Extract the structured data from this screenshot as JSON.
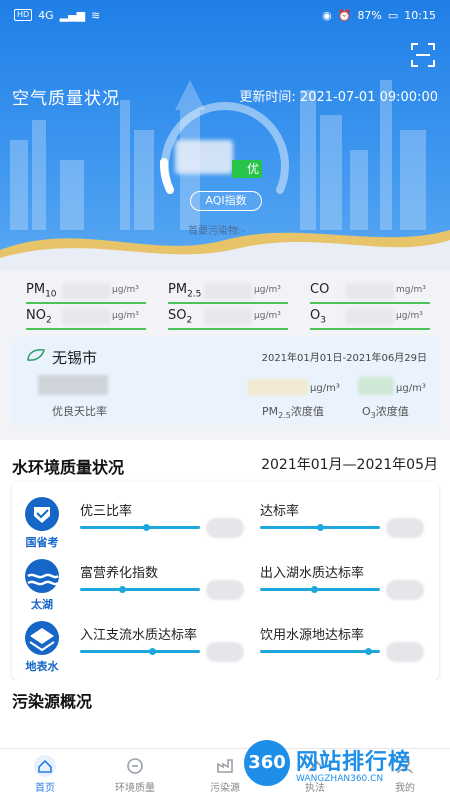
{
  "status_bar": {
    "sim": "HD",
    "net": "4G",
    "battery": "87%",
    "time": "10:15"
  },
  "air": {
    "title": "空气质量状况",
    "update_time": "更新时间: 2021-07-01 09:00:00",
    "aqi_level": "优",
    "aqi_button": "AQI指数",
    "primary_pollutant": "首要污染物:-"
  },
  "pollutants": [
    {
      "name": "PM",
      "sub": "10",
      "unit": "μg/m³"
    },
    {
      "name": "PM",
      "sub": "2.5",
      "unit": "μg/m³"
    },
    {
      "name": "CO",
      "sub": "",
      "unit": "mg/m³"
    },
    {
      "name": "NO",
      "sub": "2",
      "unit": "μg/m³"
    },
    {
      "name": "SO",
      "sub": "2",
      "unit": "μg/m³"
    },
    {
      "name": "O",
      "sub": "3",
      "unit": "μg/m³"
    }
  ],
  "city": {
    "name": "无锡市",
    "date_range": "2021年01月01日-2021年06月29日",
    "unit_pm25": "μg/m³",
    "unit_o3": "μg/m³",
    "label_good_rate": "优良天比率",
    "label_pm25": "PM",
    "label_pm25_sub": "2.5",
    "label_pm25_suffix": "浓度值",
    "label_o3": "O",
    "label_o3_sub": "3",
    "label_o3_suffix": "浓度值"
  },
  "water": {
    "title": "水环境质量状况",
    "date_range": "2021年01月—2021年05月",
    "categories": [
      {
        "label": "国省考",
        "metrics": [
          {
            "name": "优三比率",
            "level": 0.55
          },
          {
            "name": "达标率",
            "level": 0.5
          }
        ]
      },
      {
        "label": "太湖",
        "metrics": [
          {
            "name": "富营养化指数",
            "level": 0.35
          },
          {
            "name": "出入湖水质达标率",
            "level": 0.45
          }
        ]
      },
      {
        "label": "地表水",
        "metrics": [
          {
            "name": "入江支流水质达标率",
            "level": 0.6
          },
          {
            "name": "饮用水源地达标率",
            "level": 0.9
          }
        ]
      }
    ]
  },
  "pollution": {
    "title": "污染源概况"
  },
  "tabs": [
    {
      "label": "首页",
      "icon": "home-icon"
    },
    {
      "label": "环境质量",
      "icon": "environment-icon"
    },
    {
      "label": "污染源",
      "icon": "factory-icon"
    },
    {
      "label": "执法",
      "icon": "law-icon"
    },
    {
      "label": "我的",
      "icon": "user-icon"
    }
  ],
  "watermark": {
    "badge": "360",
    "text": "网站排行榜",
    "url": "WANGZHAN360.CN"
  },
  "colors": {
    "primary": "#2a7fe6",
    "good": "#27c44a",
    "water_bar": "#1ea7dd",
    "icon_blue": "#1566c7"
  }
}
